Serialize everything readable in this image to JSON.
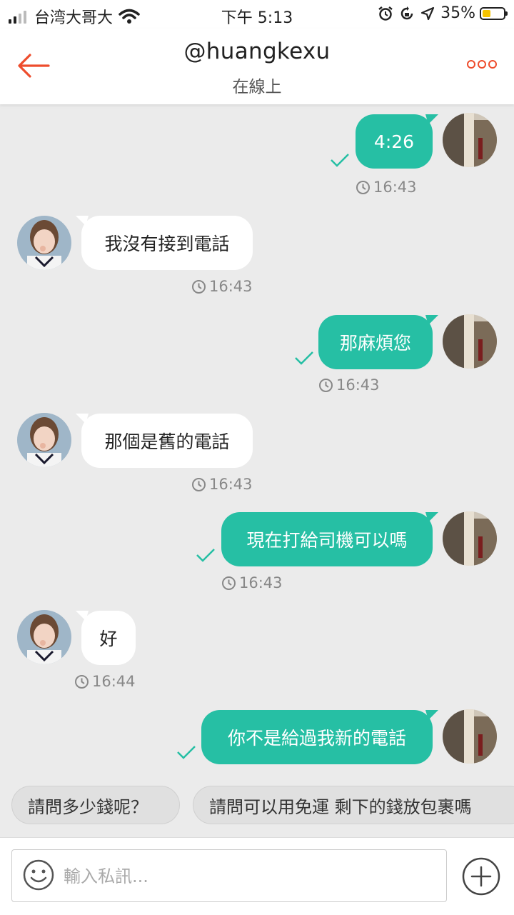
{
  "status": {
    "carrier": "台湾大哥大",
    "time": "下午 5:13",
    "battery": "35%"
  },
  "header": {
    "title": "@huangkexu",
    "status": "在線上"
  },
  "messages": [
    {
      "from": "me",
      "text": "4:26",
      "time": "16:43"
    },
    {
      "from": "them",
      "text": "我沒有接到電話",
      "time": "16:43"
    },
    {
      "from": "me",
      "text": "那麻煩您",
      "time": "16:43"
    },
    {
      "from": "them",
      "text": "那個是舊的電話",
      "time": "16:43"
    },
    {
      "from": "me",
      "text": "現在打給司機可以嗎",
      "time": "16:43"
    },
    {
      "from": "them",
      "text": "好",
      "time": "16:44"
    },
    {
      "from": "me",
      "text": "你不是給過我新的電話",
      "time": ""
    }
  ],
  "quick_replies": [
    "請問多少錢呢？",
    "請問可以用免運 剩下的錢放包裹嗎"
  ],
  "input": {
    "placeholder": "輸入私訊..."
  },
  "colors": {
    "accent": "#ee4d2d",
    "my_bubble": "#26bfa4",
    "their_bubble": "#ffffff",
    "background": "#ebebeb"
  }
}
